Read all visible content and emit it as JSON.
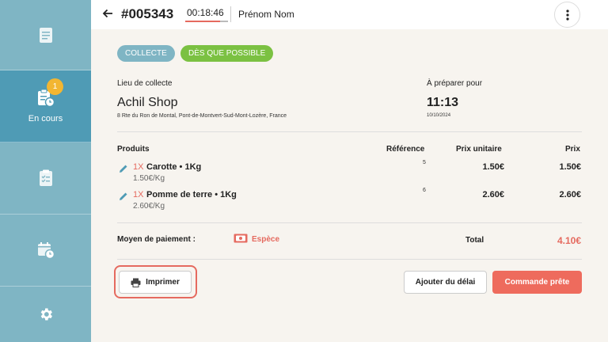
{
  "sidebar": {
    "items": [
      {
        "icon": "document-icon",
        "label": ""
      },
      {
        "icon": "clipboard-clock-icon",
        "label": "En cours",
        "badge": "1",
        "active": true
      },
      {
        "icon": "checklist-icon",
        "label": ""
      },
      {
        "icon": "calendar-clock-icon",
        "label": ""
      },
      {
        "icon": "gear-icon",
        "label": ""
      }
    ]
  },
  "header": {
    "order_number": "#005343",
    "timer": "00:18:46",
    "customer_name": "Prénom Nom"
  },
  "tags": {
    "mode": "COLLECTE",
    "timing": "DÈS QUE POSSIBLE"
  },
  "pickup": {
    "label": "Lieu de collecte",
    "shop_name": "Achil Shop",
    "address": "8 Rte du Ron de Montal, Pont-de-Montvert-Sud-Mont-Lozère, France"
  },
  "prepare": {
    "label": "À préparer pour",
    "time": "11:13",
    "date": "10/10/2024"
  },
  "table": {
    "headers": {
      "products": "Produits",
      "reference": "Référence",
      "unit_price": "Prix unitaire",
      "price": "Prix"
    },
    "rows": [
      {
        "qty": "1X",
        "name": "Carotte • 1Kg",
        "price_per_kg": "1.50€/Kg",
        "ref": "5",
        "unit_price": "1.50€",
        "price": "1.50€"
      },
      {
        "qty": "1X",
        "name": "Pomme de terre • 1Kg",
        "price_per_kg": "2.60€/Kg",
        "ref": "6",
        "unit_price": "2.60€",
        "price": "2.60€"
      }
    ]
  },
  "payment": {
    "label": "Moyen de paiement :",
    "method": "Espèce",
    "total_label": "Total",
    "total": "4.10€"
  },
  "actions": {
    "print": "Imprimer",
    "add_delay": "Ajouter du délai",
    "ready": "Commande prête"
  },
  "colors": {
    "sidebar": "#7fb5c4",
    "sidebar_active": "#4f9bb5",
    "accent": "#e56a5f",
    "green": "#7bc142",
    "badge": "#f2b632"
  }
}
